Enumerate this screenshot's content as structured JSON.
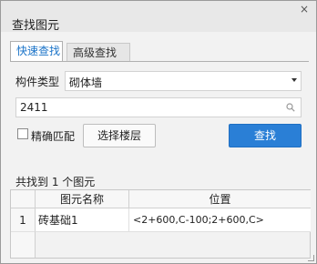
{
  "window": {
    "title": "查找图元",
    "close_glyph": "×"
  },
  "tabs": [
    {
      "label": "快速查找",
      "active": true
    },
    {
      "label": "高级查找",
      "active": false
    }
  ],
  "form": {
    "component_type_label": "构件类型",
    "component_type_value": "砌体墙",
    "search_value": "2411",
    "exact_match_label": "精确匹配",
    "exact_match_checked": false,
    "select_floor_label": "选择楼层",
    "find_label": "查找"
  },
  "results": {
    "summary": "共找到 1 个图元",
    "columns": [
      "图元名称",
      "位置"
    ],
    "rows": [
      {
        "index": "1",
        "name": "砖基础1",
        "position": "<2+600,C-100;2+600,C>"
      }
    ]
  },
  "colors": {
    "accent": "#2a7fd6",
    "active_tab_text": "#1a73c8"
  },
  "icons": {
    "search": "search-icon",
    "dropdown": "chevron-down-icon",
    "close": "close-icon"
  }
}
